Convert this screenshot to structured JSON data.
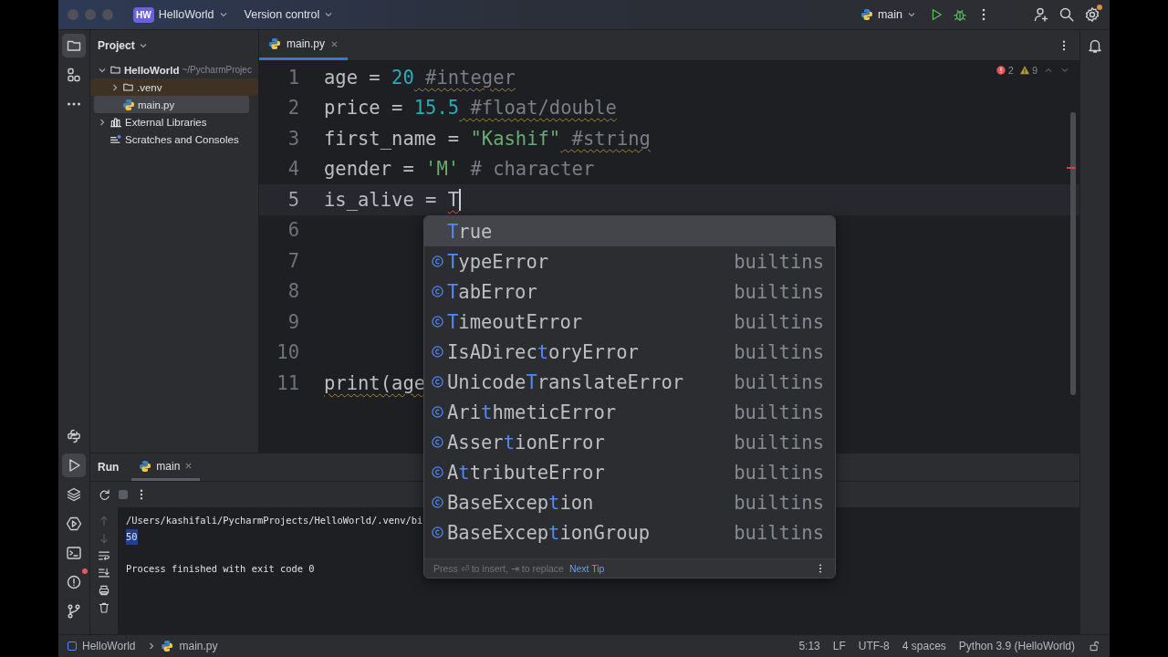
{
  "title_bar": {
    "project_badge": "HW",
    "project": "HelloWorld",
    "vcs": "Version control",
    "run_config": "main",
    "settings_notification": true
  },
  "left_toolbar": {
    "top": [
      {
        "selected": true
      },
      {
        "selected": false
      },
      {
        "selected": false
      }
    ],
    "bottom": [
      {
        "selected": false,
        "notification": false
      },
      {
        "selected": true,
        "notification": false
      },
      {
        "selected": false,
        "notification": false
      },
      {
        "selected": false,
        "notification": false
      },
      {
        "selected": false,
        "notification": false
      },
      {
        "selected": false,
        "notification": true
      },
      {
        "selected": false,
        "notification": false
      }
    ]
  },
  "project_panel": {
    "title": "Project",
    "tree": [
      {
        "kind": "folder",
        "label": "HelloWorld",
        "detail": "~/PycharmProjec",
        "expanded": true,
        "selected": false,
        "excluded": false,
        "children": [
          {
            "kind": "folder",
            "label": ".venv",
            "expanded": false,
            "selected": false,
            "excluded": true
          },
          {
            "kind": "file",
            "label": "main.py",
            "selected": true,
            "excluded": false
          }
        ]
      },
      {
        "kind": "libraries",
        "label": "External Libraries",
        "expanded": false,
        "selected": false,
        "excluded": false
      },
      {
        "kind": "scratches",
        "label": "Scratches and Consoles",
        "selected": false,
        "excluded": false
      }
    ]
  },
  "editor": {
    "tabs": [
      {
        "label": "main.py",
        "selected": true
      }
    ],
    "errors": "2",
    "warnings": "9",
    "lines": [
      {
        "number": "1",
        "current": false,
        "tokens": [
          {
            "text": "age = ",
            "kind": "plain"
          },
          {
            "text": "20",
            "kind": "number"
          },
          {
            "text": " #integer",
            "kind": "comment",
            "warning": true
          }
        ]
      },
      {
        "number": "2",
        "current": false,
        "tokens": [
          {
            "text": "price = ",
            "kind": "plain"
          },
          {
            "text": "15.5",
            "kind": "number"
          },
          {
            "text": " #float/double",
            "kind": "comment",
            "warning": true
          }
        ]
      },
      {
        "number": "3",
        "current": false,
        "tokens": [
          {
            "text": "first_name = ",
            "kind": "plain"
          },
          {
            "text": "\"Kashif\"",
            "kind": "string"
          },
          {
            "text": " #string",
            "kind": "comment",
            "warning": true
          }
        ]
      },
      {
        "number": "4",
        "current": false,
        "tokens": [
          {
            "text": "gender = ",
            "kind": "plain"
          },
          {
            "text": "'M'",
            "kind": "string"
          },
          {
            "text": " # character",
            "kind": "comment"
          }
        ]
      },
      {
        "number": "5",
        "current": true,
        "tokens": [
          {
            "text": "is_alive = ",
            "kind": "plain"
          },
          {
            "text": "T",
            "kind": "plain",
            "error": true
          }
        ]
      },
      {
        "number": "6",
        "current": false
      },
      {
        "number": "7",
        "current": false
      },
      {
        "number": "8",
        "current": false
      },
      {
        "number": "9",
        "current": false
      },
      {
        "number": "10",
        "current": false
      },
      {
        "number": "11",
        "current": false,
        "tokens": [
          {
            "text": "print(age",
            "kind": "plain",
            "warning": true
          }
        ]
      }
    ]
  },
  "completion": {
    "items": [
      {
        "kind": "keyword",
        "match": "T",
        "suffix": "rue",
        "selected": true
      },
      {
        "kind": "class",
        "match": "T",
        "suffix": "ypeError",
        "source": "builtins",
        "selected": false
      },
      {
        "kind": "class",
        "match": "T",
        "suffix": "abError",
        "source": "builtins",
        "selected": false
      },
      {
        "kind": "class",
        "match": "T",
        "suffix": "imeoutError",
        "source": "builtins",
        "selected": false
      },
      {
        "kind": "class",
        "prefix": "IsADirec",
        "match": "t",
        "suffix": "oryError",
        "source": "builtins",
        "selected": false
      },
      {
        "kind": "class",
        "prefix": "Unicode",
        "match": "T",
        "suffix": "ranslateError",
        "source": "builtins",
        "selected": false
      },
      {
        "kind": "class",
        "prefix": "Ari",
        "match": "t",
        "suffix": "hmeticError",
        "source": "builtins",
        "selected": false
      },
      {
        "kind": "class",
        "prefix": "Asser",
        "match": "t",
        "suffix": "ionError",
        "source": "builtins",
        "selected": false
      },
      {
        "kind": "class",
        "prefix": "A",
        "match": "t",
        "suffix": "tributeError",
        "source": "builtins",
        "selected": false
      },
      {
        "kind": "class",
        "prefix": "BaseExcep",
        "match": "t",
        "suffix": "ion",
        "source": "builtins",
        "selected": false
      },
      {
        "kind": "class",
        "prefix": "BaseExcep",
        "match": "t",
        "suffix": "ionGroup",
        "source": "builtins",
        "selected": false
      }
    ],
    "hint": "Press ⏎ to insert, ⇥ to replace",
    "next_tip": "Next Tip"
  },
  "run_panel": {
    "title": "Run",
    "tabs": [
      {
        "label": "main",
        "selected": true
      }
    ],
    "output": [
      {
        "text": "/Users/kashifali/PycharmProjects/HelloWorld/.venv/bi",
        "selected": false
      },
      {
        "text": "50",
        "selected": true
      },
      {
        "text": "Process finished with exit code 0",
        "selected": false
      }
    ]
  },
  "status_bar": {
    "breadcrumbs": [
      "HelloWorld",
      "main.py"
    ],
    "items": [
      "5:13",
      "LF",
      "UTF-8",
      "4 spaces",
      "Python 3.9 (HelloWorld)"
    ]
  }
}
